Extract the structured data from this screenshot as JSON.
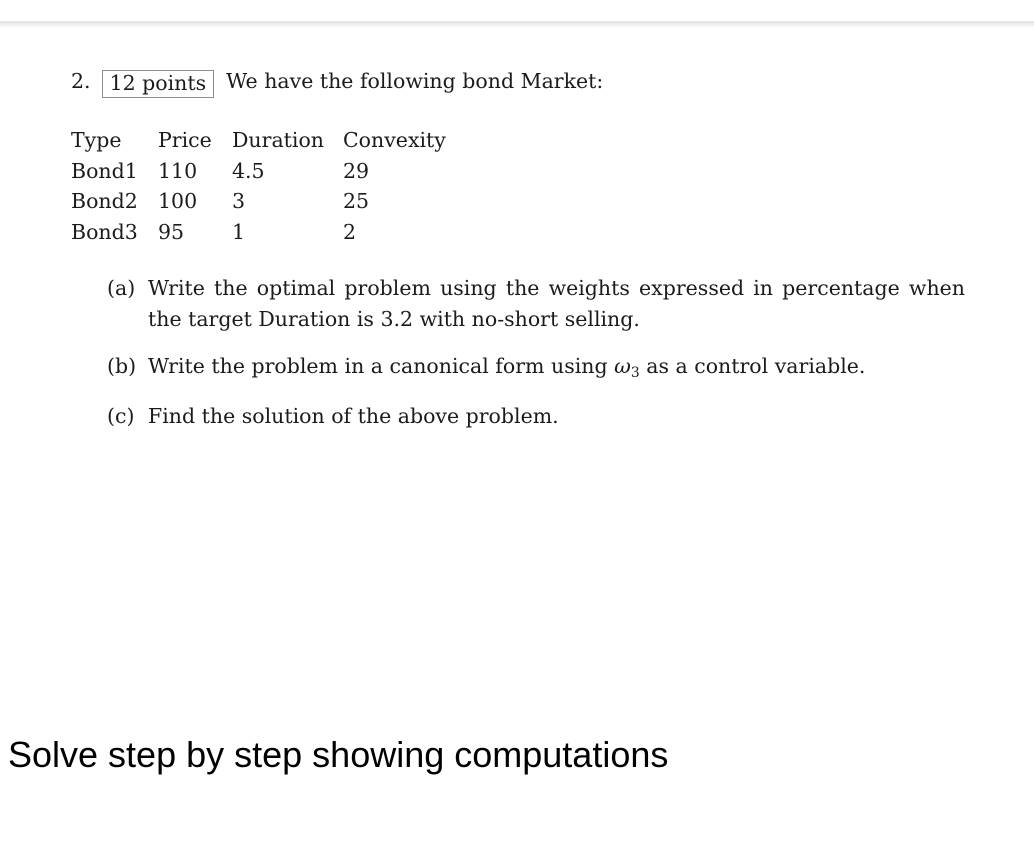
{
  "document": {
    "problem": {
      "number": "2.",
      "points_badge": "12 points",
      "statement": "We have the following bond Market:"
    },
    "table": {
      "headers": [
        "Type",
        "Price",
        "Duration",
        "Convexity"
      ],
      "rows": [
        [
          "Bond1",
          "110",
          "4.5",
          "29"
        ],
        [
          "Bond2",
          "100",
          "3",
          "25"
        ],
        [
          "Bond3",
          "95",
          "1",
          "2"
        ]
      ]
    },
    "questions": [
      {
        "label": "(a)",
        "text": "Write the optimal problem using the weights expressed in percentage when the target Duration is 3.2 with no-short selling."
      },
      {
        "label": "(b)",
        "text_before": "Write the problem in a canonical form using ",
        "variable": "ω",
        "variable_subscript": "3",
        "text_after": " as a control variable."
      },
      {
        "label": "(c)",
        "text": "Find the solution of the above problem."
      }
    ]
  },
  "instruction": {
    "text": "Solve step by step showing computations"
  },
  "colors": {
    "text": "#1b1b1b",
    "instruction_text": "#000000",
    "box_border": "#8d8d8f",
    "page_background": "#ffffff",
    "header_shadow": "#e3e3e4"
  }
}
